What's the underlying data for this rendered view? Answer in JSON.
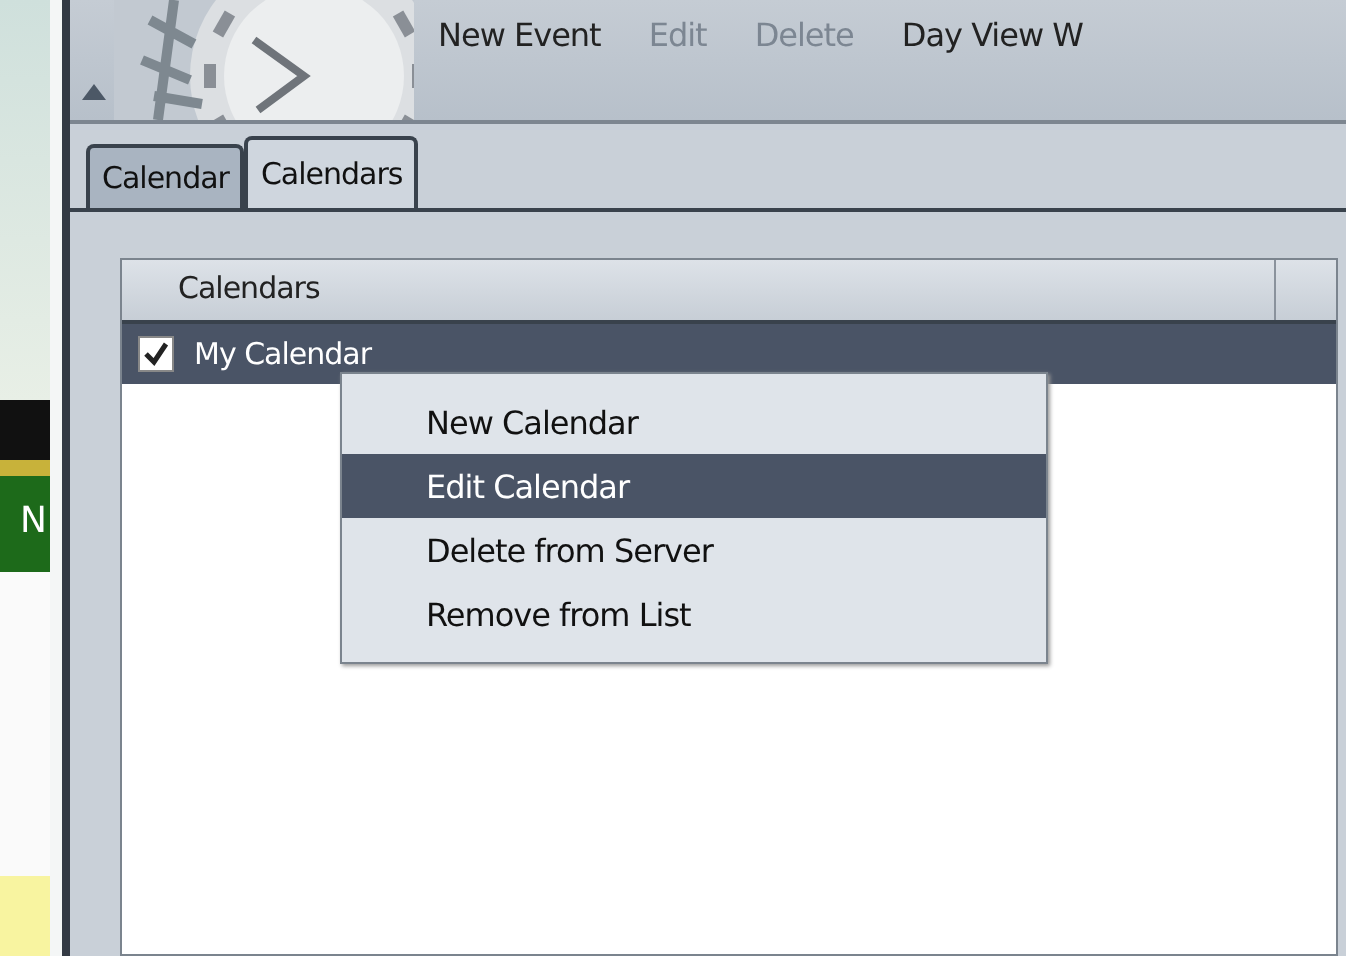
{
  "side_strip": {
    "text": "N"
  },
  "toolbar": {
    "buttons": [
      {
        "label": "New Event",
        "disabled": false
      },
      {
        "label": "Edit",
        "disabled": true
      },
      {
        "label": "Delete",
        "disabled": true
      },
      {
        "label": "Day View W",
        "disabled": false
      }
    ]
  },
  "tabs": [
    {
      "label": "Calendar",
      "selected": false
    },
    {
      "label": "Calendars",
      "selected": true
    }
  ],
  "list": {
    "columns": [
      "Calendars"
    ],
    "rows": [
      {
        "label": "My Calendar",
        "checked": true,
        "selected": true
      }
    ]
  },
  "context_menu": {
    "items": [
      {
        "label": "New Calendar",
        "selected": false
      },
      {
        "label": "Edit Calendar",
        "selected": true
      },
      {
        "label": "Delete from Server",
        "selected": false
      },
      {
        "label": "Remove from List",
        "selected": false
      }
    ]
  }
}
